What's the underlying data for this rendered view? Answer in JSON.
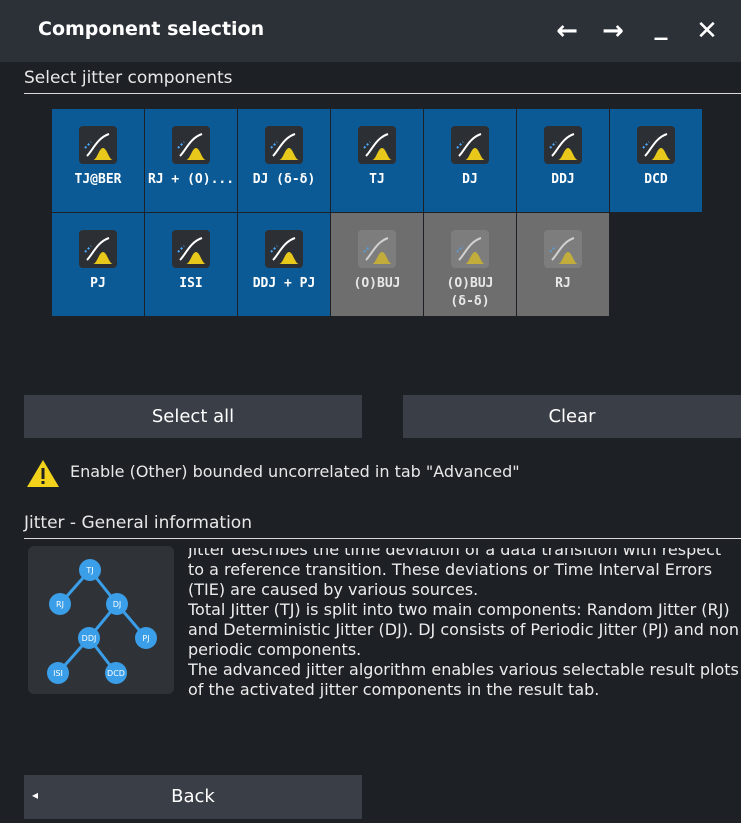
{
  "window": {
    "title": "Component selection",
    "controls": [
      "←",
      "→",
      "_",
      "✕"
    ]
  },
  "section_select": {
    "title": "Select jitter components"
  },
  "tiles": [
    {
      "label": "TJ@BER",
      "enabled": true,
      "icon": "tj-ber-icon"
    },
    {
      "label": "RJ + (O)...",
      "enabled": true,
      "icon": "rj-obuj-icon"
    },
    {
      "label": "DJ (δ-δ)",
      "enabled": true,
      "icon": "dj-dual-dirac-icon"
    },
    {
      "label": "TJ",
      "enabled": true,
      "icon": "tj-icon"
    },
    {
      "label": "DJ",
      "enabled": true,
      "icon": "dj-icon"
    },
    {
      "label": "DDJ",
      "enabled": true,
      "icon": "ddj-icon"
    },
    {
      "label": "DCD",
      "enabled": true,
      "icon": "dcd-icon"
    },
    {
      "label": "PJ",
      "enabled": true,
      "icon": "pj-icon"
    },
    {
      "label": "ISI",
      "enabled": true,
      "icon": "isi-icon"
    },
    {
      "label": "DDJ + PJ",
      "enabled": true,
      "icon": "ddj-pj-icon"
    },
    {
      "label": "(O)BUJ",
      "enabled": false,
      "icon": "obuj-icon"
    },
    {
      "label": "(O)BUJ\n(δ-δ)",
      "enabled": false,
      "icon": "obuj-dual-dirac-icon"
    },
    {
      "label": "RJ",
      "enabled": false,
      "icon": "rj-icon"
    }
  ],
  "buttons": {
    "select_all": "Select all",
    "clear": "Clear",
    "back": "Back"
  },
  "warning": {
    "text": "Enable (Other) bounded uncorrelated in tab \"Advanced\"",
    "icon": "warning-icon"
  },
  "section_info": {
    "title": "Jitter - General information"
  },
  "info_tree": {
    "nodes": [
      "TJ",
      "RJ",
      "DJ",
      "DDJ",
      "PJ",
      "ISI",
      "DCD"
    ]
  },
  "info_text": "Jitter describes the time deviation of a data transition with respect to a reference transition. These deviations or Time Interval Errors (TIE) are caused by various sources.\nTotal Jitter (TJ) is split into two main components: Random Jitter (RJ) and Deterministic Jitter (DJ). DJ consists of Periodic Jitter (PJ) and non periodic components.\nThe advanced jitter algorithm enables various selectable result plots of the activated jitter components in the result tab.",
  "colors": {
    "tile_enabled": "#0c5a95",
    "tile_disabled": "#6e6e6e",
    "icon_yellow": "#e8c81a",
    "icon_blue": "#4aa8ff",
    "tree_node": "#3b9ee8"
  }
}
